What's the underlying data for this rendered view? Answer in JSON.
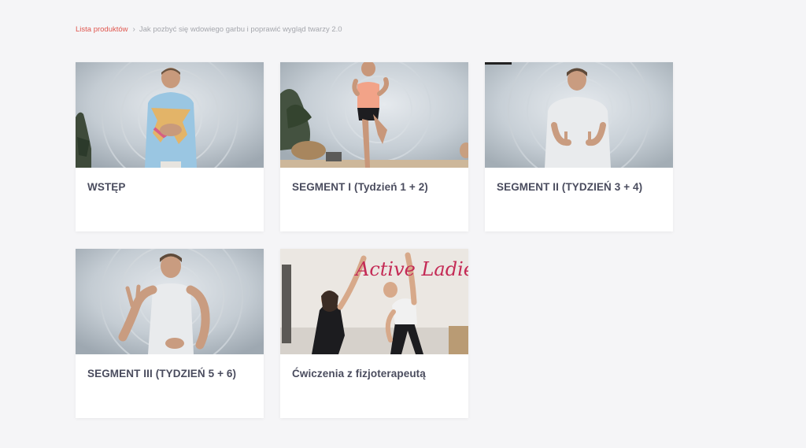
{
  "breadcrumb": {
    "root_label": "Lista produktów",
    "separator_icon": "chevron-right-icon",
    "current_label": "Jak pozbyć się wdowiego garbu i poprawić wygląd twarzy 2.0"
  },
  "lessons": [
    {
      "title": "WSTĘP"
    },
    {
      "title": "SEGMENT I (Tydzień 1 + 2)"
    },
    {
      "title": "SEGMENT II (TYDZIEŃ 3 + 4)"
    },
    {
      "title": "SEGMENT III (TYDZIEŃ 5 + 6)"
    },
    {
      "title": "Ćwiczenia z fizjoterapeutą",
      "thumbnail_text": "Active Ladies"
    }
  ],
  "colors": {
    "accent": "#e0574f",
    "page_background": "#f5f5f7",
    "card_title": "#4a4c5e",
    "thumbnail_text": "#c42a55"
  }
}
